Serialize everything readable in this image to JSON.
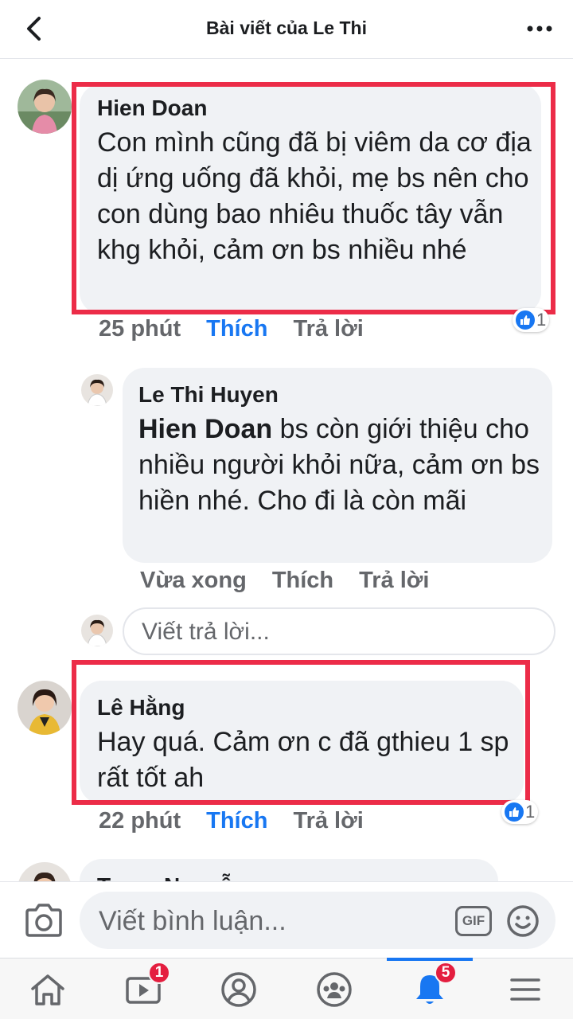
{
  "header": {
    "title": "Bài viết của Le Thi",
    "back_icon": "chevron-left-icon",
    "more_icon": "more-horizontal-icon"
  },
  "comments": [
    {
      "author": "Hien Doan",
      "text": "Con mình cũng đã bị viêm da cơ địa dị ứng uống đã khỏi, mẹ bs nên cho con dùng bao nhiêu thuốc tây vẫn khg khỏi, cảm ơn bs nhiều nhé",
      "time": "25 phút",
      "like_label": "Thích",
      "reply_label": "Trả lời",
      "reaction_count": "1"
    },
    {
      "author": "Le Thi Huyen",
      "mention": "Hien Doan",
      "text": " bs còn giới thiệu cho nhiều người khỏi nữa, cảm ơn bs hiền nhé. Cho đi là còn mãi",
      "time": "Vừa xong",
      "like_label": "Thích",
      "reply_label": "Trả lời"
    },
    {
      "author": "Lê Hằng",
      "text": "Hay quá. Cảm ơn c đã gthieu 1 sp rất tốt ah",
      "time": "22 phút",
      "like_label": "Thích",
      "reply_label": "Trả lời",
      "reaction_count": "1"
    },
    {
      "author": "Trang Nguyễn"
    }
  ],
  "reply_placeholder": "Viết trả lời...",
  "compose": {
    "placeholder": "Viết bình luận...",
    "gif_label": "GIF",
    "camera_icon": "camera-icon",
    "emoji_icon": "emoji-icon"
  },
  "nav": {
    "items": [
      {
        "icon": "home-icon"
      },
      {
        "icon": "watch-icon",
        "badge": "1"
      },
      {
        "icon": "profile-icon"
      },
      {
        "icon": "groups-icon"
      },
      {
        "icon": "bell-icon",
        "badge": "5",
        "active": true
      },
      {
        "icon": "menu-icon"
      }
    ]
  },
  "colors": {
    "accent": "#1877f2",
    "highlight": "#ec2c48",
    "badge": "#e41e3f",
    "bubble": "#f0f2f5"
  }
}
